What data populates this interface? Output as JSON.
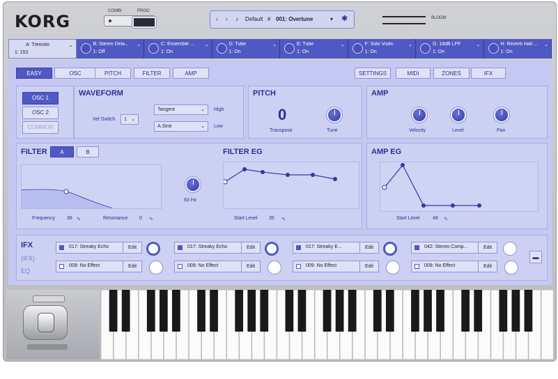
{
  "header": {
    "logo": "KORG",
    "mode_left": "COMBI",
    "mode_right": "PROG",
    "preset_default": "Default",
    "preset_hash": "#",
    "preset_name": "001: Overtune",
    "bloom_label": "BLOOM"
  },
  "slots": [
    {
      "name": "A: Tremolo",
      "value": "1: 152",
      "active": true
    },
    {
      "name": "B: Stereo Dela...",
      "value": "1: Off"
    },
    {
      "name": "C: Ensemble ...",
      "value": "1: On"
    },
    {
      "name": "D: Tube",
      "value": "1: On"
    },
    {
      "name": "E: Tube",
      "value": "1: On"
    },
    {
      "name": "F: Solo Violin",
      "value": "1: On"
    },
    {
      "name": "G: 18dB LPF",
      "value": "1: On"
    },
    {
      "name": "H: Reverb Hall ...",
      "value": "1: On"
    }
  ],
  "tabs_left": [
    "EASY",
    "OSC",
    "PITCH",
    "FILTER",
    "AMP"
  ],
  "tabs_right": [
    "SETTINGS",
    "MIDI",
    "ZONES",
    "IFX"
  ],
  "osc": {
    "osc1": "OSC 1",
    "osc2": "OSC 2",
    "common": "COMMON"
  },
  "waveform": {
    "title": "WAVEFORM",
    "vel_switch_label": "Vel Switch",
    "vel_switch_value": "1",
    "high_wave": "Tangent",
    "high_label": "High",
    "low_wave": "A.Sine",
    "low_label": "Low"
  },
  "pitch": {
    "title": "PITCH",
    "transpose_value": "0",
    "transpose_label": "Transpose",
    "tune_label": "Tune"
  },
  "amp": {
    "title": "AMP",
    "velocity_label": "Velocity",
    "level_label": "Level",
    "pan_label": "Pan"
  },
  "filter": {
    "title": "FILTER",
    "tab_a": "A",
    "tab_b": "B",
    "frequency_label": "Frequency",
    "frequency_value": "36",
    "resonance_label": "Resonance",
    "resonance_value": "0",
    "knob_value": "63 Hz"
  },
  "filter_eg": {
    "title": "FILTER EG",
    "start_label": "Start Level",
    "start_value": "35"
  },
  "amp_eg": {
    "title": "AMP EG",
    "start_label": "Start Level",
    "start_value": "48"
  },
  "ifx": {
    "title": "IFX",
    "sub": "(IFX)",
    "eq": "EQ",
    "edit": "Edit",
    "row1": [
      "017: Streaky Echo",
      "017: Streaky Echo",
      "017: Streaky E...",
      "042: Stereo Comp..."
    ],
    "row2": [
      "009: No Effect",
      "009: No Effect",
      "009: No Effect",
      "009: No Effect"
    ]
  },
  "colors": {
    "accent": "#4f58c3",
    "panel": "#c5c9f2"
  }
}
